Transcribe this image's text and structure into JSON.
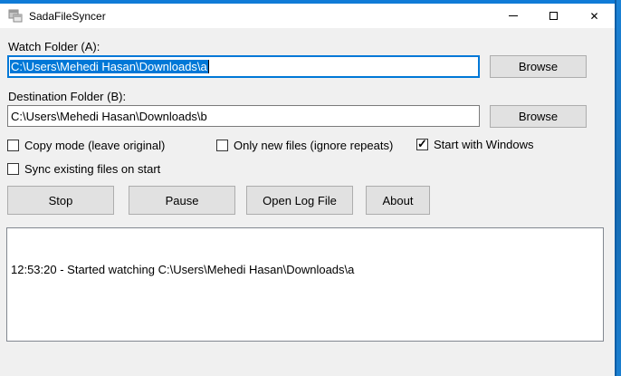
{
  "window": {
    "title": "SadaFileSyncer",
    "close_glyph": "✕"
  },
  "colors": {
    "accent": "#0078d7",
    "titlebar_top": "#0f7bd7",
    "desktop_blue": "#1b7fd0"
  },
  "icons": {
    "check_glyph": "✓"
  },
  "form": {
    "watch_label": "Watch Folder (A):",
    "watch_value": "C:\\Users\\Mehedi Hasan\\Downloads\\a",
    "dest_label": "Destination Folder (B):",
    "dest_value": "C:\\Users\\Mehedi Hasan\\Downloads\\b",
    "browse_label": "Browse"
  },
  "checkboxes": [
    {
      "label": "Copy mode (leave original)",
      "checked": false
    },
    {
      "label": "Only new files (ignore repeats)",
      "checked": false
    },
    {
      "label": "Start with Windows",
      "checked": true
    },
    {
      "label": "Sync existing files on start",
      "checked": false
    }
  ],
  "buttons": {
    "stop": "Stop",
    "pause": "Pause",
    "open_log": "Open Log File",
    "about": "About"
  },
  "log": {
    "lines": [
      "12:53:20 - Started watching C:\\Users\\Mehedi Hasan\\Downloads\\a"
    ]
  }
}
